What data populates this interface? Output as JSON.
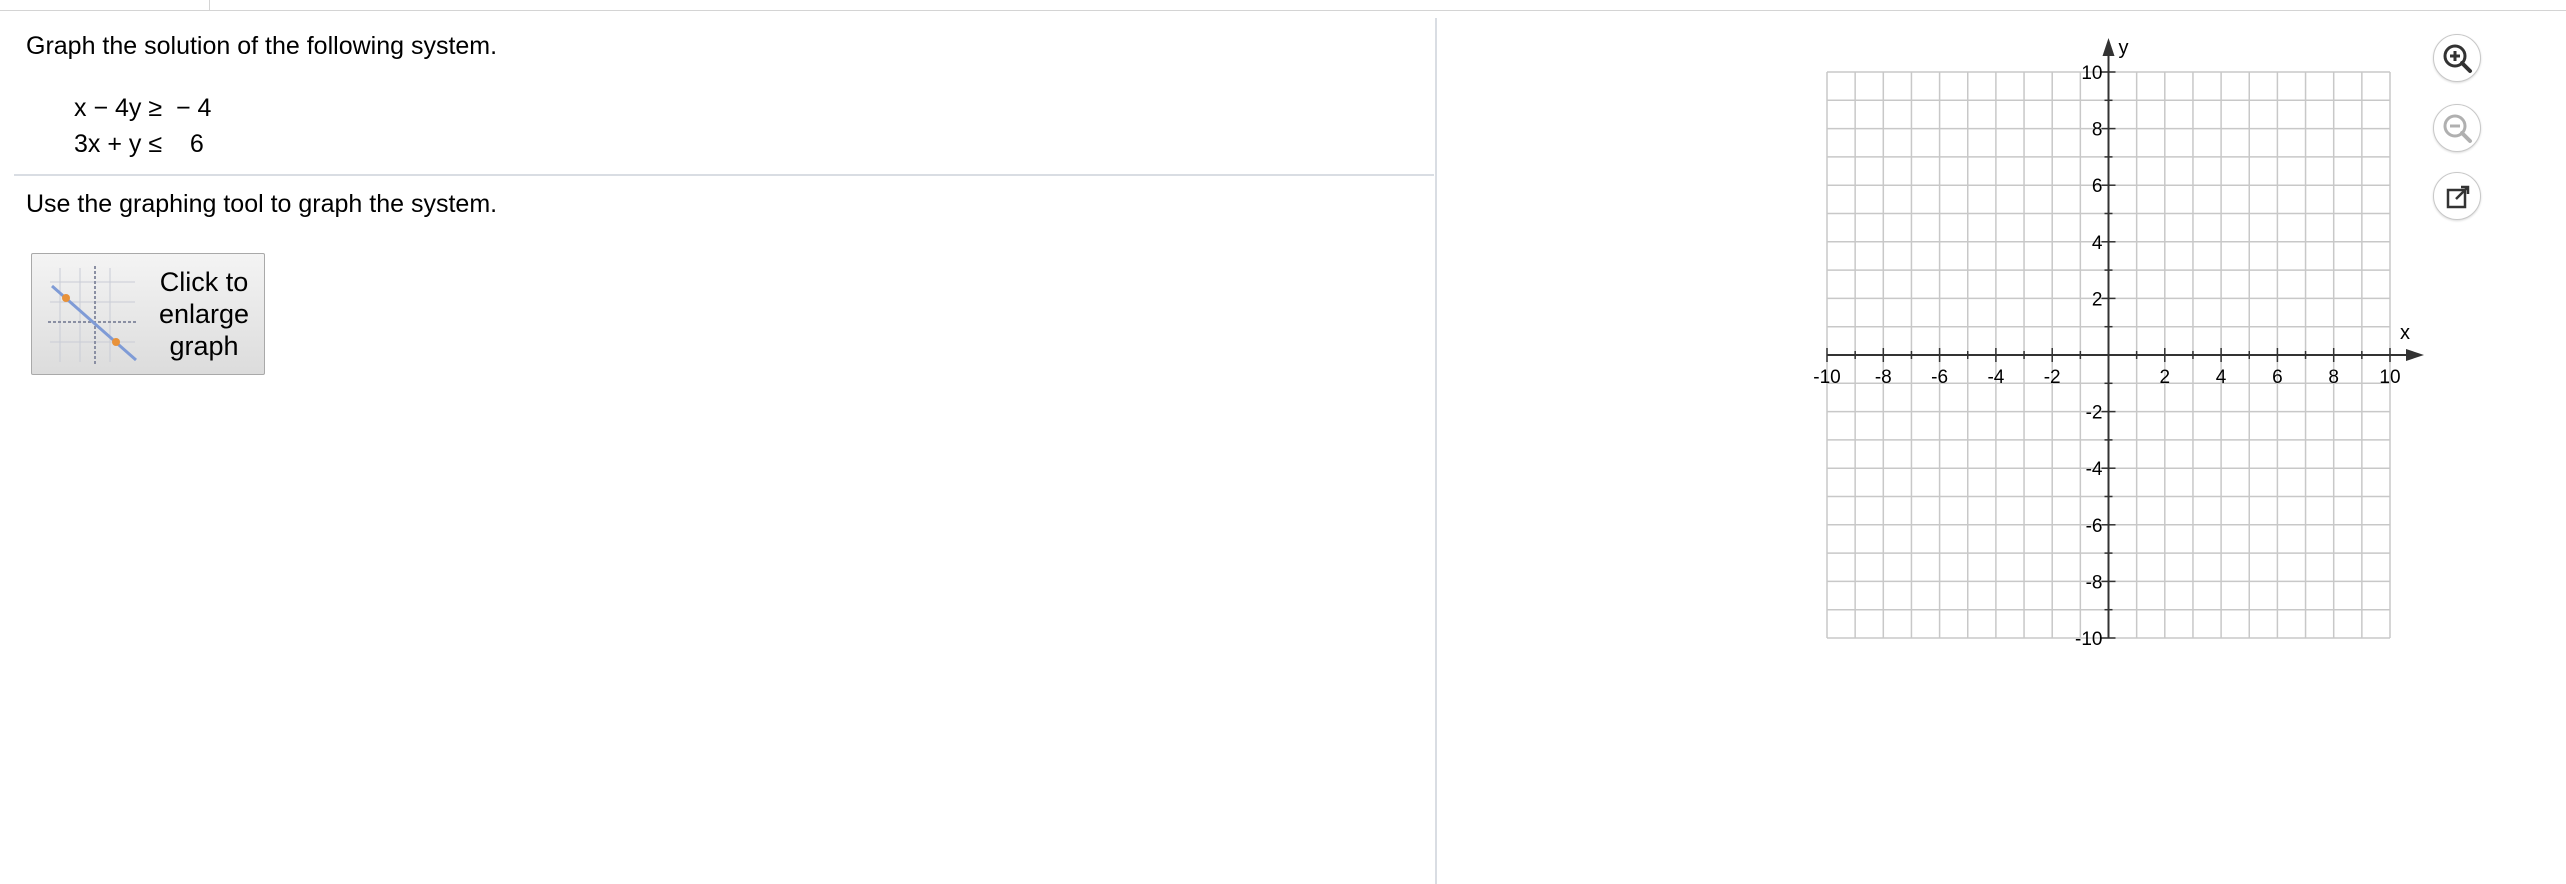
{
  "question": {
    "prompt": "Graph the solution of the following system.",
    "inequalities": [
      "x − 4y ≥  − 4",
      "3x + y ≤    6"
    ],
    "instruction": "Use the graphing tool to graph the system."
  },
  "enlarge_button": {
    "label_lines": [
      "Click to",
      "enlarge",
      "graph"
    ]
  },
  "graph": {
    "x_axis_label": "x",
    "y_axis_label": "y",
    "x_range": [
      -10,
      10
    ],
    "y_range": [
      -10,
      10
    ],
    "grid": true,
    "x_tick_labels": [
      "-10",
      "-8",
      "-6",
      "-4",
      "-2",
      "2",
      "4",
      "6",
      "8",
      "10"
    ],
    "y_tick_labels": [
      "10",
      "8",
      "6",
      "4",
      "2",
      "-2",
      "-4",
      "-6",
      "-8",
      "-10"
    ]
  },
  "tools": [
    {
      "icon": "zoom-in-icon"
    },
    {
      "icon": "zoom-out-icon"
    },
    {
      "icon": "popout-icon"
    }
  ],
  "colors": {
    "grid": "#c8c8c8",
    "axis": "#333333",
    "divider": "#d9dde3"
  }
}
